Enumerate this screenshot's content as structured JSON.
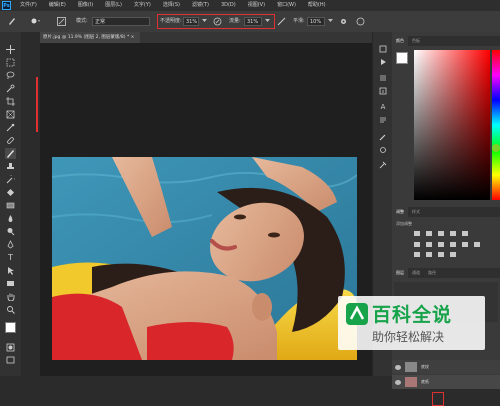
{
  "app": {
    "logo": "Ps"
  },
  "menu": {
    "items": [
      "文件(F)",
      "编辑(E)",
      "图像(I)",
      "图层(L)",
      "文字(Y)",
      "选择(S)",
      "滤镜(T)",
      "3D(D)",
      "视图(V)",
      "窗口(W)",
      "帮助(H)"
    ]
  },
  "options": {
    "mode_label": "模式:",
    "mode_value": "正常",
    "opacity_label": "不透明度:",
    "opacity_value": "31%",
    "flow_label": "流量:",
    "flow_value": "31%",
    "smooth_label": "平滑:",
    "smooth_value": "10%"
  },
  "document": {
    "tab_title": "原片.jpg @ 11.9% (图层 2, 图层蒙版/8) *"
  },
  "panels": {
    "color_tabs": [
      "颜色",
      "色板"
    ],
    "adjust_tabs": [
      "调整",
      "样式"
    ],
    "adjust_add_label": "添加调整",
    "layers_tabs": [
      "图层",
      "通道",
      "路径"
    ],
    "layer_names": [
      "底纹",
      "底纸"
    ]
  },
  "watermark": {
    "title": "百科全说",
    "subtitle": "助你轻松解决"
  },
  "colors": {
    "accent": "#e03030",
    "photo_water": "#3a8fb0",
    "swimsuit": "#d8262a",
    "float": "#f2c92a"
  }
}
